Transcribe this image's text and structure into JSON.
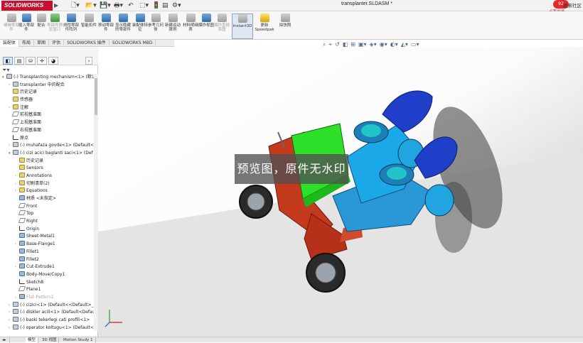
{
  "app": {
    "logo_text": "SOLIDWORKS",
    "document_title": "transplanter.SLDASM *",
    "search_label": "搜索社区",
    "notification_count": "92",
    "notification_label": "点我加速"
  },
  "commands": [
    {
      "label": "编辑零部件",
      "state": "disabled"
    },
    {
      "label": "插入零部件",
      "state": "normal"
    },
    {
      "label": "配合",
      "state": "normal"
    },
    {
      "label": "零部件预览窗口",
      "state": "disabled"
    },
    {
      "label": "线性零部件阵列",
      "state": "normal"
    },
    {
      "label": "智能扣件",
      "state": "normal"
    },
    {
      "label": "移动零部件",
      "state": "normal"
    },
    {
      "label": "显示隐藏的零部件",
      "state": "normal"
    },
    {
      "label": "装配体特征",
      "state": "normal"
    },
    {
      "label": "参考几何体",
      "state": "normal"
    },
    {
      "label": "新建运动算例",
      "state": "normal"
    },
    {
      "label": "材料明细表",
      "state": "normal"
    },
    {
      "label": "爆炸视图",
      "state": "normal"
    },
    {
      "label": "爆炸直线草图",
      "state": "disabled"
    },
    {
      "label": "Instant3D",
      "state": "active"
    },
    {
      "label": "更新 Speedpak",
      "state": "normal"
    },
    {
      "label": "拍快照",
      "state": "normal"
    }
  ],
  "ribbon_tabs": [
    "装配体",
    "布局",
    "草图",
    "评估",
    "SOLIDWORKS 插件",
    "SOLIDWORKS MBD"
  ],
  "bottom_tabs": [
    "模型",
    "3D 视图",
    "Motion Study 1"
  ],
  "tree": [
    {
      "depth": 0,
      "toggle": "▾",
      "icon": "part",
      "label": "(-) Transplanting mechanism<1> (默认<",
      "dim": false
    },
    {
      "depth": 1,
      "toggle": "›",
      "icon": "part",
      "label": "transplanter 中的配合",
      "dim": false
    },
    {
      "depth": 1,
      "toggle": "",
      "icon": "fold",
      "label": "历史记录",
      "dim": false
    },
    {
      "depth": 1,
      "toggle": "",
      "icon": "fold",
      "label": "传感器",
      "dim": false
    },
    {
      "depth": 1,
      "toggle": "›",
      "icon": "fold",
      "label": "注解",
      "dim": false
    },
    {
      "depth": 1,
      "toggle": "",
      "icon": "plane",
      "label": "前视基准面",
      "dim": false
    },
    {
      "depth": 1,
      "toggle": "",
      "icon": "plane",
      "label": "上视基准面",
      "dim": false
    },
    {
      "depth": 1,
      "toggle": "",
      "icon": "plane",
      "label": "右视基准面",
      "dim": false
    },
    {
      "depth": 1,
      "toggle": "",
      "icon": "sketch",
      "label": "原点",
      "dim": false
    },
    {
      "depth": 1,
      "toggle": "›",
      "icon": "part",
      "label": "(-) muhafaza govde<1> (Default<",
      "dim": false
    },
    {
      "depth": 1,
      "toggle": "▾",
      "icon": "part",
      "label": "(-) cizi acici baglanti saci<1> (Def",
      "dim": false
    },
    {
      "depth": 2,
      "toggle": "",
      "icon": "fold",
      "label": "历史记录",
      "dim": false
    },
    {
      "depth": 2,
      "toggle": "",
      "icon": "fold",
      "label": "Sensors",
      "dim": false
    },
    {
      "depth": 2,
      "toggle": "›",
      "icon": "fold",
      "label": "Annotations",
      "dim": false
    },
    {
      "depth": 2,
      "toggle": "›",
      "icon": "fold",
      "label": "切割清单(2)",
      "dim": false
    },
    {
      "depth": 2,
      "toggle": "›",
      "icon": "fold",
      "label": "Equations",
      "dim": false
    },
    {
      "depth": 2,
      "toggle": "",
      "icon": "feat",
      "label": "材质 <未指定>",
      "dim": false
    },
    {
      "depth": 2,
      "toggle": "",
      "icon": "plane",
      "label": "Front",
      "dim": false
    },
    {
      "depth": 2,
      "toggle": "",
      "icon": "plane",
      "label": "Top",
      "dim": false
    },
    {
      "depth": 2,
      "toggle": "",
      "icon": "plane",
      "label": "Right",
      "dim": false
    },
    {
      "depth": 2,
      "toggle": "",
      "icon": "sketch",
      "label": "Origin",
      "dim": false
    },
    {
      "depth": 2,
      "toggle": "",
      "icon": "feat",
      "label": "Sheet-Metal1",
      "dim": false
    },
    {
      "depth": 2,
      "toggle": "›",
      "icon": "feat",
      "label": "Base-Flange1",
      "dim": false
    },
    {
      "depth": 2,
      "toggle": "",
      "icon": "feat",
      "label": "Fillet1",
      "dim": false
    },
    {
      "depth": 2,
      "toggle": "",
      "icon": "feat",
      "label": "Fillet2",
      "dim": false
    },
    {
      "depth": 2,
      "toggle": "›",
      "icon": "feat",
      "label": "Cut-Extrude1",
      "dim": false
    },
    {
      "depth": 2,
      "toggle": "",
      "icon": "feat",
      "label": "Body-Move/Copy1",
      "dim": false
    },
    {
      "depth": 2,
      "toggle": "",
      "icon": "sketch",
      "label": "Sketch8",
      "dim": false
    },
    {
      "depth": 2,
      "toggle": "",
      "icon": "plane",
      "label": "Plane1",
      "dim": false
    },
    {
      "depth": 2,
      "toggle": "›",
      "icon": "feat",
      "label": "Flat-Pattern1",
      "dim": true
    },
    {
      "depth": 1,
      "toggle": "›",
      "icon": "part",
      "label": "(-) cizici<1> (Default<<Default>_P",
      "dim": false
    },
    {
      "depth": 1,
      "toggle": "›",
      "icon": "part",
      "label": "(-) diskler acili<1> (Default<Defau",
      "dim": false
    },
    {
      "depth": 1,
      "toggle": "›",
      "icon": "part",
      "label": "(-) baski tekerlegi cati profili<1>",
      "dim": false
    },
    {
      "depth": 1,
      "toggle": "›",
      "icon": "part",
      "label": "(-) operator koltugu<1> (Default<",
      "dim": false
    }
  ],
  "viewport": {
    "watermark_text": "预览图，原件无水印"
  },
  "colors": {
    "brand_red": "#c8102e",
    "frame_red": "#c43a1d",
    "box_green": "#2fe02a",
    "hopper_blue": "#1aa8e8",
    "seat_blue": "#1f3fc9"
  }
}
